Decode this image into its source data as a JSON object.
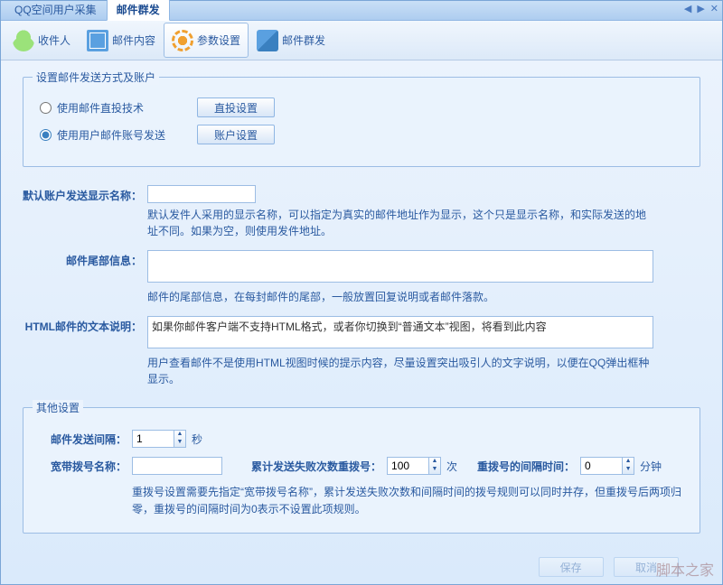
{
  "tabs": {
    "main": "QQ空间用户采集",
    "active": "邮件群发"
  },
  "toolbar": {
    "recipients": "收件人",
    "content": "邮件内容",
    "params": "参数设置",
    "send": "邮件群发"
  },
  "group_send_method": {
    "legend": "设置邮件发送方式及账户",
    "opt_direct": "使用邮件直投技术",
    "btn_direct": "直投设置",
    "opt_account": "使用用户邮件账号发送",
    "btn_account": "账户设置"
  },
  "form": {
    "display_name_label": "默认账户发送显示名称：",
    "display_name_value": "",
    "display_name_hint": "默认发件人采用的显示名称，可以指定为真实的邮件地址作为显示，这个只是显示名称，和实际发送的地址不同。如果为空，则使用发件地址。",
    "footer_label": "邮件尾部信息：",
    "footer_value": "",
    "footer_hint": "邮件的尾部信息，在每封邮件的尾部，一般放置回复说明或者邮件落款。",
    "html_label": "HTML邮件的文本说明：",
    "html_value": "如果你邮件客户端不支持HTML格式，或者你切换到“普通文本”视图，将看到此内容",
    "html_hint": "用户查看邮件不是使用HTML视图时候的提示内容，尽量设置突出吸引人的文字说明，以便在QQ弹出框种显示。"
  },
  "other": {
    "legend": "其他设置",
    "interval_label": "邮件发送间隔：",
    "interval_value": "1",
    "interval_unit": "秒",
    "dial_label": "宽带拨号名称：",
    "dial_value": "",
    "fail_label": "累计发送失败次数重拨号：",
    "fail_value": "100",
    "fail_unit": "次",
    "redial_label": "重拨号的间隔时间：",
    "redial_value": "0",
    "redial_unit": "分钟",
    "hint": "重拨号设置需要先指定“宽带拨号名称”，累计发送失败次数和间隔时间的拨号规则可以同时并存，但重拨号后两项归零，重拨号的间隔时间为0表示不设置此项规则。"
  },
  "footer": {
    "save": "保存",
    "cancel": "取消"
  },
  "watermark": "脚本之家"
}
